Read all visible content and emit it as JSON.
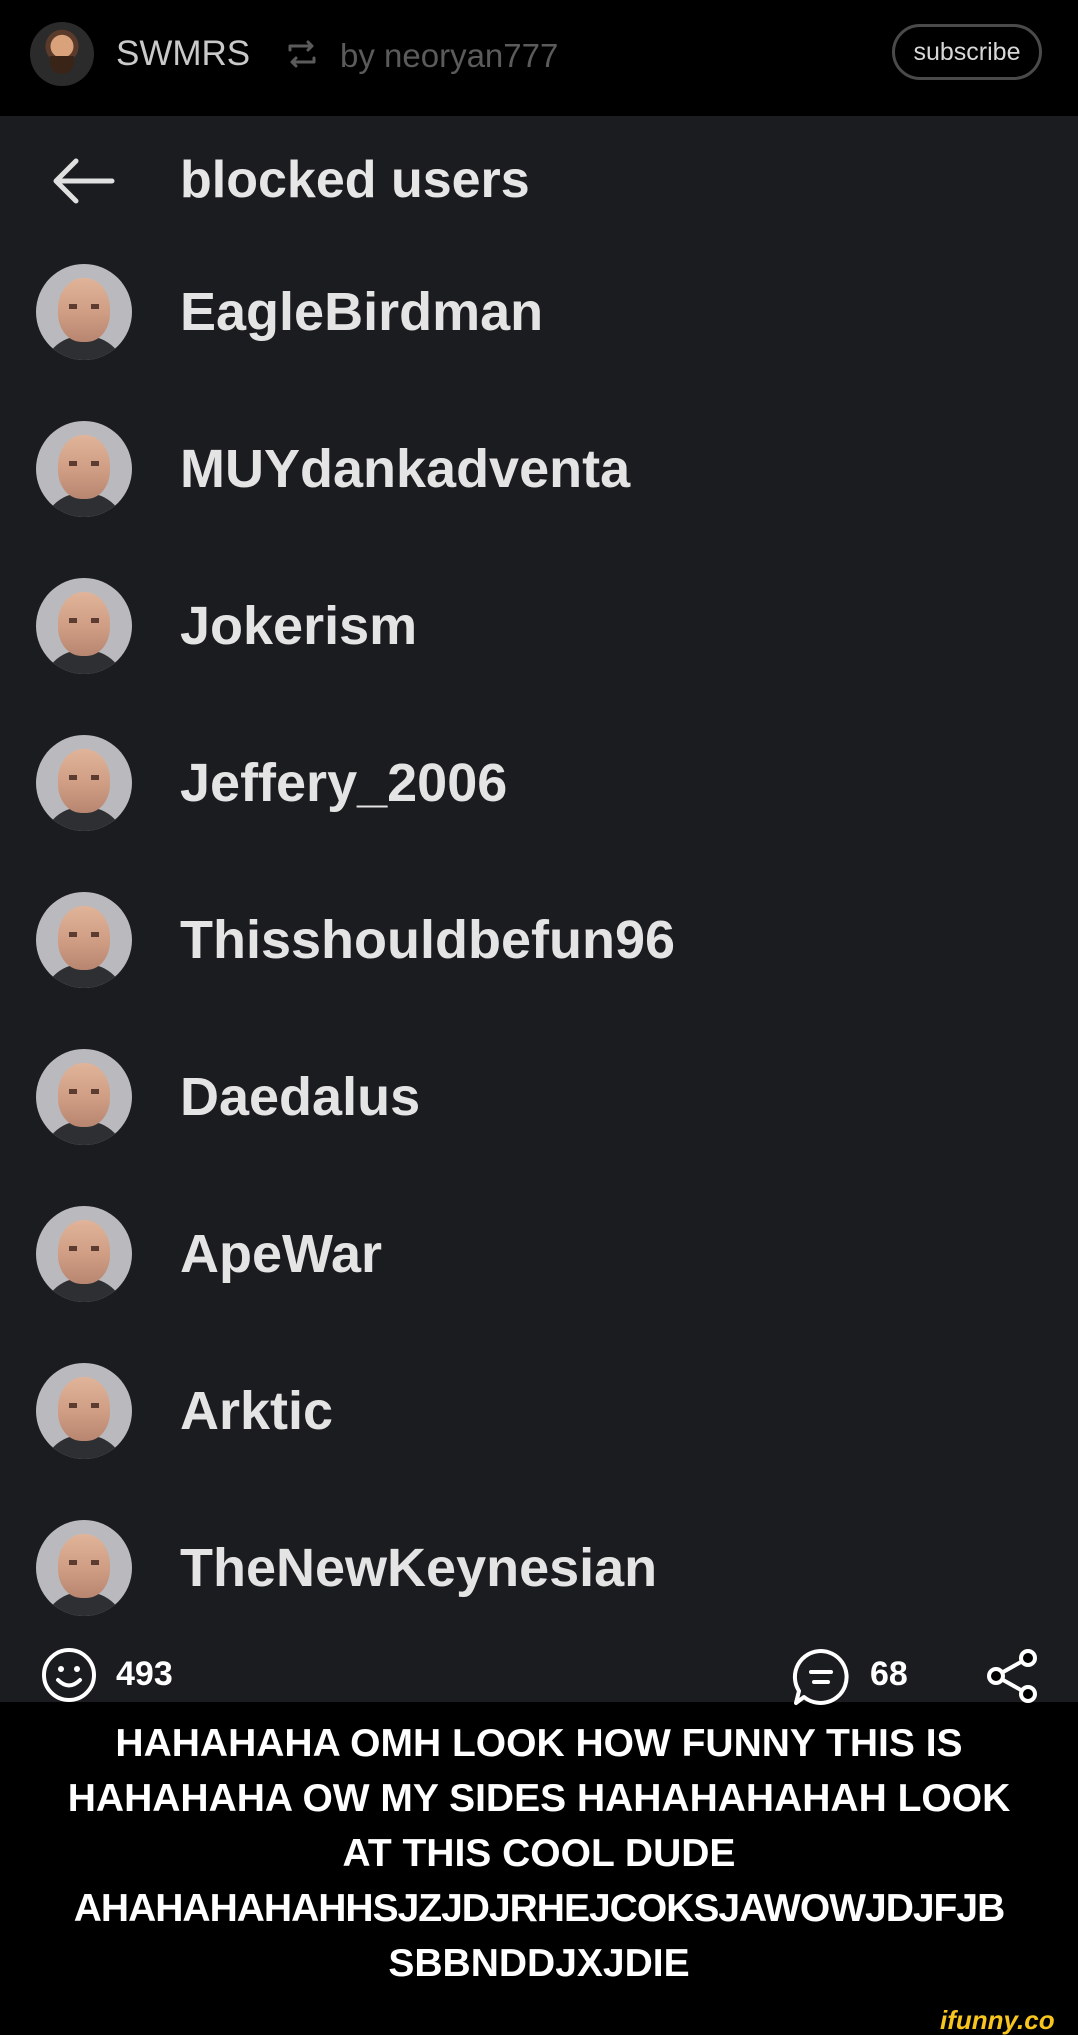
{
  "header": {
    "author_name": "SWMRS",
    "by_line": "by neoryan777",
    "subscribe_label": "subscribe",
    "repost_icon": "repost-icon"
  },
  "screenshot": {
    "title": "blocked users",
    "back_icon": "back-arrow-icon",
    "blocked_users": [
      {
        "name": "EagleBirdman"
      },
      {
        "name": "MUYdankadventa"
      },
      {
        "name": "Jokerism"
      },
      {
        "name": "Jeffery_2006"
      },
      {
        "name": "Thisshouldbefun96"
      },
      {
        "name": "Daedalus"
      },
      {
        "name": "ApeWar"
      },
      {
        "name": "Arktic"
      },
      {
        "name": "TheNewKeynesian"
      }
    ]
  },
  "reactions": {
    "smile_count": "493",
    "comment_count": "68",
    "smile_icon": "smile-icon",
    "comment_icon": "comment-icon",
    "share_icon": "share-icon"
  },
  "caption": {
    "lines": [
      "HAHAHAHA OMH LOOK HOW FUNNY THIS IS",
      "HAHAHAHA OW MY SIDES HAHAHAHAHAH LOOK",
      "AT THIS COOL DUDE",
      "AHAHAHAHAHHSJZJDJRHEJCOKSJAWOWJDJFJB",
      "SBBNDDJXJDIE"
    ]
  },
  "watermark": "ifunny.co",
  "colors": {
    "panel_background": "#1b1c20",
    "page_background": "#000000",
    "watermark": "#f7c51e"
  }
}
